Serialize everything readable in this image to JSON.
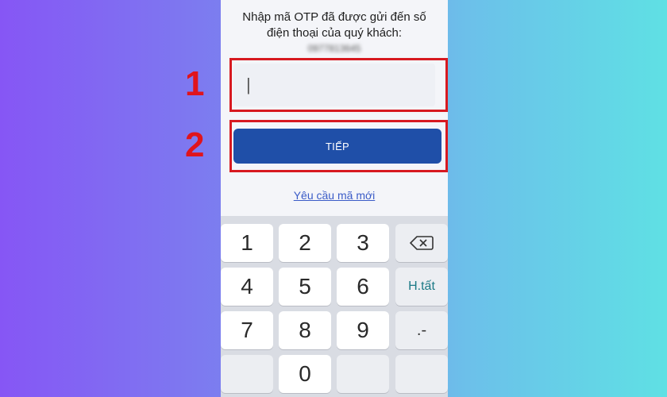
{
  "prompt": {
    "line1": "Nhập mã OTP đã được gửi đến số",
    "line2": "điện thoại của quý khách:",
    "phone_number": "0977813645"
  },
  "otp_input": {
    "value": "",
    "placeholder": "|"
  },
  "next_button": {
    "label": "TIẾP"
  },
  "resend_link": {
    "label": "Yêu cầu mã mới"
  },
  "annotations": {
    "step1": "1",
    "step2": "2",
    "highlight_color": "#d71920"
  },
  "keypad": {
    "keys": [
      "1",
      "2",
      "3",
      "4",
      "5",
      "6",
      "7",
      "8",
      "9",
      "0"
    ],
    "backspace_icon": "backspace-icon",
    "done_label": "H.tất",
    "punctuation_label": ".-"
  },
  "colors": {
    "accent": "#1f4fa8",
    "link": "#3a5bc7",
    "background_gradient": [
      "#8656f5",
      "#5fe0e4"
    ]
  }
}
